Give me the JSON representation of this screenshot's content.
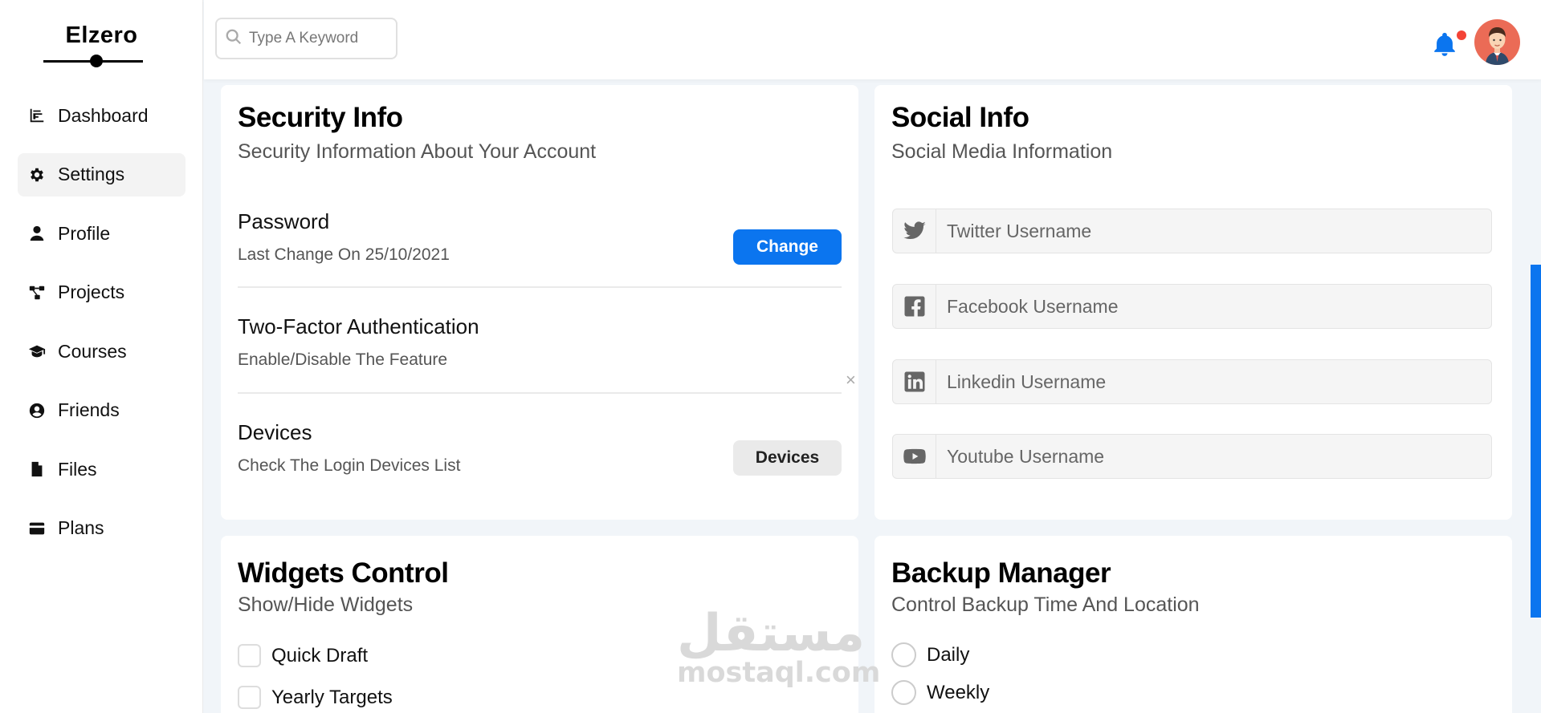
{
  "brand": {
    "name": "Elzero"
  },
  "sidebar": {
    "items": [
      {
        "label": "Dashboard",
        "icon": "chart-icon"
      },
      {
        "label": "Settings",
        "icon": "gear-icon",
        "active": true
      },
      {
        "label": "Profile",
        "icon": "user-icon"
      },
      {
        "label": "Projects",
        "icon": "diagram-icon"
      },
      {
        "label": "Courses",
        "icon": "graduation-cap-icon"
      },
      {
        "label": "Friends",
        "icon": "user-circle-icon"
      },
      {
        "label": "Files",
        "icon": "file-icon"
      },
      {
        "label": "Plans",
        "icon": "credit-card-icon"
      }
    ]
  },
  "header": {
    "search_placeholder": "Type A Keyword",
    "accent_color": "#0b75ef",
    "notification_dot_color": "#f44336"
  },
  "security": {
    "title": "Security Info",
    "subtitle": "Security Information About Your Account",
    "password_title": "Password",
    "password_desc": "Last Change On 25/10/2021",
    "change_label": "Change",
    "twofa_title": "Two-Factor Authentication",
    "twofa_desc": "Enable/Disable The Feature",
    "devices_title": "Devices",
    "devices_desc": "Check The Login Devices List",
    "devices_label": "Devices",
    "close_symbol": "×"
  },
  "social": {
    "title": "Social Info",
    "subtitle": "Social Media Information",
    "fields": [
      {
        "placeholder": "Twitter Username",
        "icon": "twitter-icon"
      },
      {
        "placeholder": "Facebook Username",
        "icon": "facebook-icon"
      },
      {
        "placeholder": "Linkedin Username",
        "icon": "linkedin-icon"
      },
      {
        "placeholder": "Youtube Username",
        "icon": "youtube-icon"
      }
    ]
  },
  "widgets": {
    "title": "Widgets Control",
    "subtitle": "Show/Hide Widgets",
    "options": [
      "Quick Draft",
      "Yearly Targets"
    ]
  },
  "backup": {
    "title": "Backup Manager",
    "subtitle": "Control Backup Time And Location",
    "options": [
      "Daily",
      "Weekly"
    ]
  },
  "watermark": {
    "arabic": "مستقل",
    "latin": "mostaql.com"
  }
}
